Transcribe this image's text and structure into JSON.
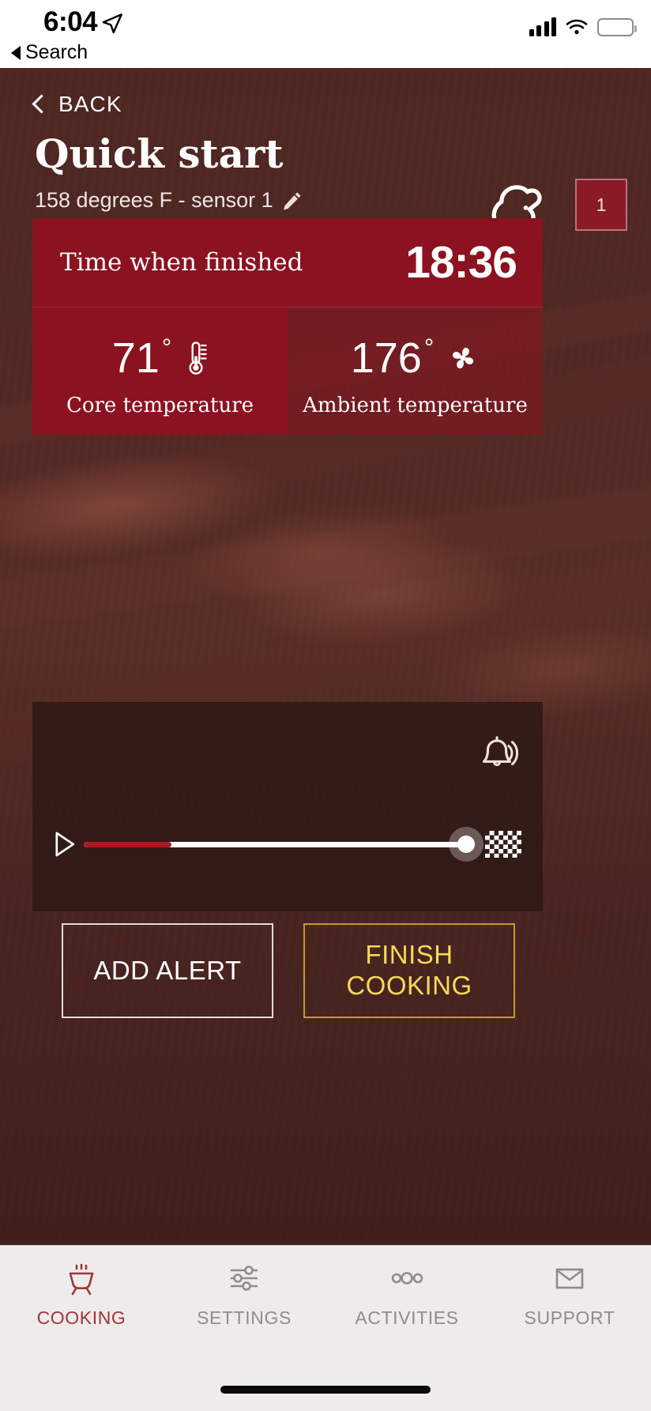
{
  "status_bar": {
    "time": "6:04",
    "back_app_label": "Search",
    "location_icon": "location-arrow-icon",
    "signal_icon": "cellular-signal-icon",
    "wifi_icon": "wifi-icon",
    "battery_icon": "battery-icon"
  },
  "header": {
    "back_label": "BACK",
    "back_icon": "chevron-left-icon",
    "title": "Quick start",
    "subtitle": "158 degrees F - sensor 1",
    "edit_icon": "pencil-icon",
    "food_icon": "poultry-icon",
    "probe_badge": "1"
  },
  "card": {
    "finish_label": "Time when finished",
    "finish_time": "18:36",
    "core": {
      "value": "71",
      "degree": "°",
      "label": "Core temperature",
      "icon": "thermometer-icon"
    },
    "ambient": {
      "value": "176",
      "degree": "°",
      "label": "Ambient temperature",
      "icon": "fan-icon"
    }
  },
  "slider_panel": {
    "alarm_icon": "bell-ringing-icon",
    "play_icon": "play-triangle-icon",
    "finish_flag_icon": "checkered-flag-icon",
    "progress_percent": 20,
    "handle_position_percent": 92
  },
  "actions": {
    "add_alert": "ADD ALERT",
    "finish_cooking": "FINISH\nCOOKING",
    "finish_cooking_line1": "FINISH",
    "finish_cooking_line2": "COOKING"
  },
  "tabbar": {
    "items": [
      {
        "label": "COOKING",
        "icon": "grill-icon",
        "active": true
      },
      {
        "label": "SETTINGS",
        "icon": "sliders-icon",
        "active": false
      },
      {
        "label": "ACTIVITIES",
        "icon": "three-circles-icon",
        "active": false
      },
      {
        "label": "SUPPORT",
        "icon": "envelope-icon",
        "active": false
      }
    ]
  },
  "colors": {
    "brand_red": "#8b1220",
    "accent_gold": "#f5d95a",
    "active_tab": "#a3333a",
    "slider_fill": "#a81c22",
    "panel_bg": "#301a16",
    "tabbar_bg": "#eeecea"
  }
}
